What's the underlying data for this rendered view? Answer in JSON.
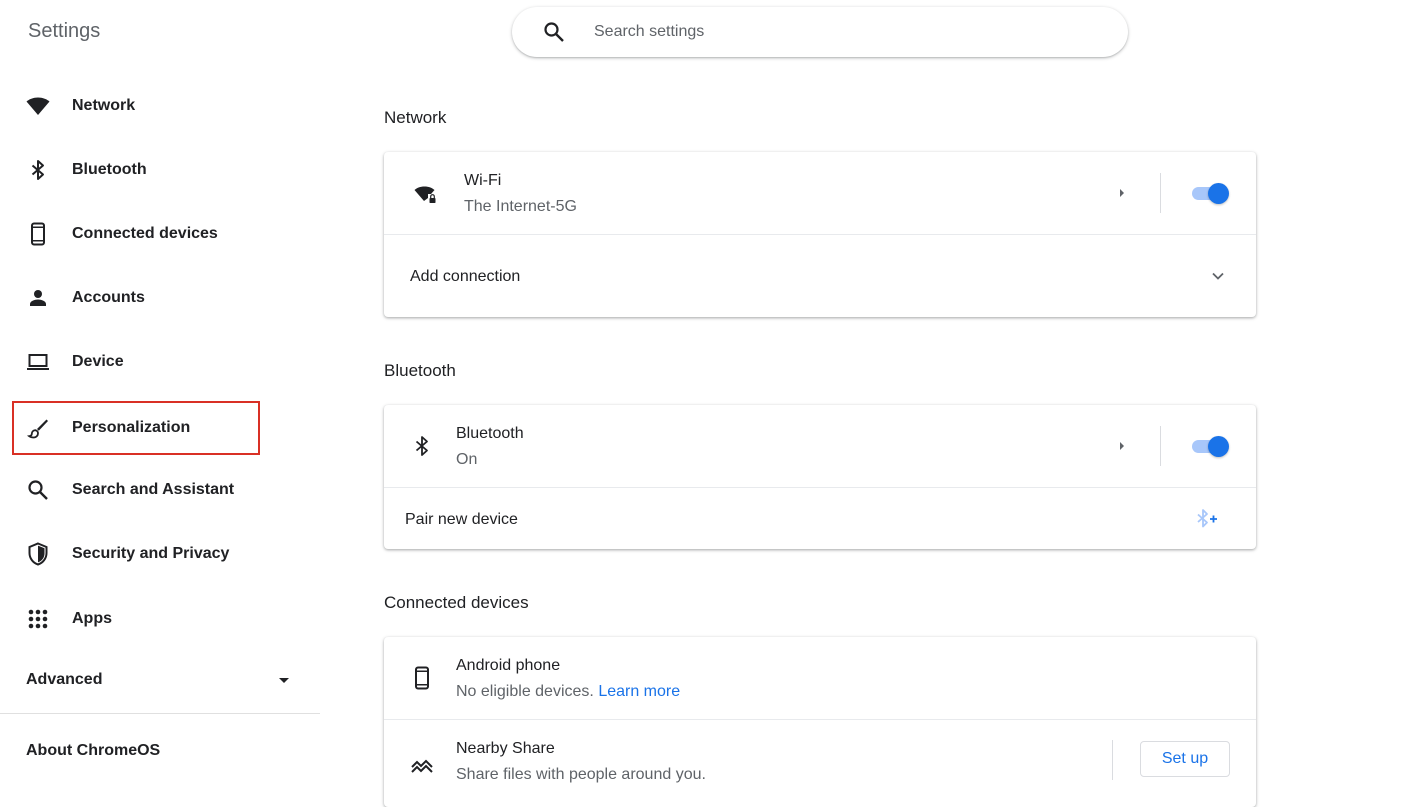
{
  "app": {
    "title": "Settings"
  },
  "search": {
    "placeholder": "Search settings",
    "icon": "search-icon"
  },
  "sidebar": {
    "items": [
      {
        "label": "Network",
        "icon": "wifi-icon"
      },
      {
        "label": "Bluetooth",
        "icon": "bluetooth-icon"
      },
      {
        "label": "Connected devices",
        "icon": "phone-icon"
      },
      {
        "label": "Accounts",
        "icon": "person-icon"
      },
      {
        "label": "Device",
        "icon": "laptop-icon"
      },
      {
        "label": "Personalization",
        "icon": "brush-icon",
        "selected": true
      },
      {
        "label": "Search and Assistant",
        "icon": "search-icon"
      },
      {
        "label": "Security and Privacy",
        "icon": "shield-icon"
      },
      {
        "label": "Apps",
        "icon": "apps-grid-icon"
      }
    ],
    "advanced_label": "Advanced",
    "about_label": "About ChromeOS"
  },
  "main": {
    "network": {
      "title": "Network",
      "wifi": {
        "title": "Wi-Fi",
        "subtitle": "The Internet-5G",
        "enabled": true
      },
      "add_connection": "Add connection"
    },
    "bluetooth": {
      "title": "Bluetooth",
      "bt": {
        "title": "Bluetooth",
        "subtitle": "On",
        "enabled": true
      },
      "pair_new": "Pair new device"
    },
    "connected": {
      "title": "Connected devices",
      "android": {
        "title": "Android phone",
        "subtitle": "No eligible devices.",
        "link": "Learn more"
      },
      "nearby": {
        "title": "Nearby Share",
        "subtitle": "Share files with people around you.",
        "button": "Set up"
      }
    }
  },
  "colors": {
    "accent": "#1a73e8",
    "selection_outline": "#d93025"
  }
}
